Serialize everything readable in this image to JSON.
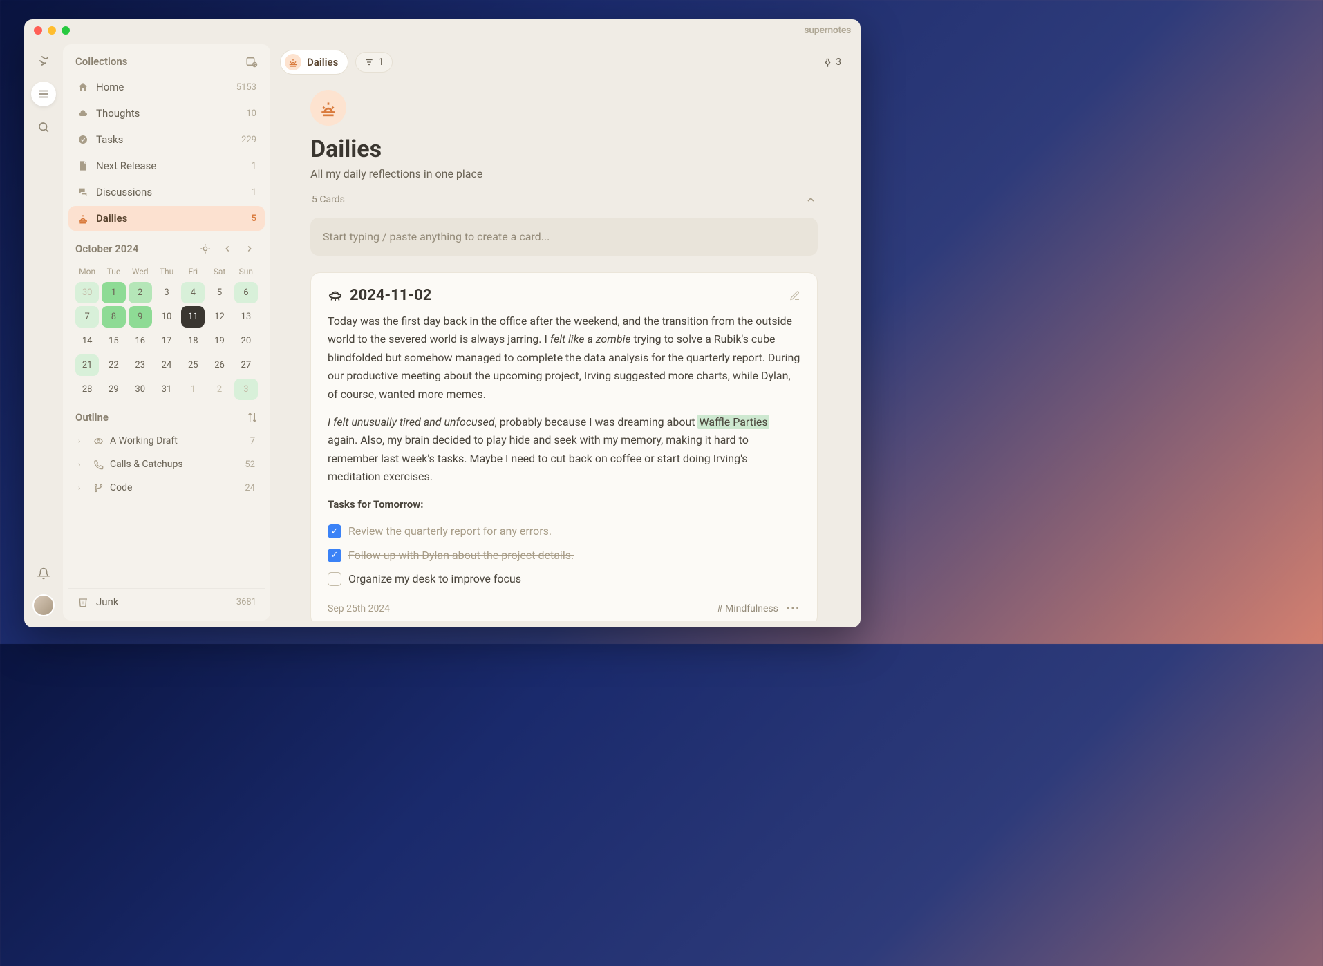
{
  "brand": "supernotes",
  "sidebar": {
    "title": "Collections",
    "items": [
      {
        "label": "Home",
        "count": "5153",
        "icon": "home"
      },
      {
        "label": "Thoughts",
        "count": "10",
        "icon": "thought"
      },
      {
        "label": "Tasks",
        "count": "229",
        "icon": "check"
      },
      {
        "label": "Next Release",
        "count": "1",
        "icon": "doc"
      },
      {
        "label": "Discussions",
        "count": "1",
        "icon": "chat"
      },
      {
        "label": "Dailies",
        "count": "5",
        "icon": "sunrise",
        "active": true
      }
    ],
    "junk": {
      "label": "Junk",
      "count": "3681"
    }
  },
  "calendar": {
    "title": "October 2024",
    "dow": [
      "Mon",
      "Tue",
      "Wed",
      "Thu",
      "Fri",
      "Sat",
      "Sun"
    ],
    "days": [
      {
        "n": "30",
        "dim": true,
        "heat": "light"
      },
      {
        "n": "1",
        "heat": "strong"
      },
      {
        "n": "2",
        "heat": "med"
      },
      {
        "n": "3"
      },
      {
        "n": "4",
        "heat": "light"
      },
      {
        "n": "5"
      },
      {
        "n": "6",
        "heat": "light"
      },
      {
        "n": "7",
        "heat": "light"
      },
      {
        "n": "8",
        "heat": "strong"
      },
      {
        "n": "9",
        "heat": "strong"
      },
      {
        "n": "10"
      },
      {
        "n": "11",
        "today": true
      },
      {
        "n": "12"
      },
      {
        "n": "13"
      },
      {
        "n": "14"
      },
      {
        "n": "15"
      },
      {
        "n": "16"
      },
      {
        "n": "17"
      },
      {
        "n": "18"
      },
      {
        "n": "19"
      },
      {
        "n": "20"
      },
      {
        "n": "21",
        "heat": "light"
      },
      {
        "n": "22"
      },
      {
        "n": "23"
      },
      {
        "n": "24"
      },
      {
        "n": "25"
      },
      {
        "n": "26"
      },
      {
        "n": "27"
      },
      {
        "n": "28"
      },
      {
        "n": "29"
      },
      {
        "n": "30"
      },
      {
        "n": "31"
      },
      {
        "n": "1",
        "dim": true
      },
      {
        "n": "2",
        "dim": true
      },
      {
        "n": "3",
        "dim": true,
        "heat": "light"
      }
    ]
  },
  "outline": {
    "title": "Outline",
    "items": [
      {
        "label": "A Working Draft",
        "count": "7",
        "icon": "draft"
      },
      {
        "label": "Calls & Catchups",
        "count": "52",
        "icon": "phone"
      },
      {
        "label": "Code",
        "count": "24",
        "icon": "branch"
      }
    ]
  },
  "header": {
    "breadcrumb": "Dailies",
    "filter_count": "1",
    "pin_count": "3"
  },
  "page": {
    "title": "Dailies",
    "description": "All my daily reflections in one place",
    "cards_count": "5 Cards",
    "compose_placeholder": "Start typing / paste anything to create a card..."
  },
  "card": {
    "title": "2024-11-02",
    "p1_a": "Today was the first day back in the office after the weekend, and the transition from the outside world to the severed world is always jarring. I ",
    "p1_em": "felt like a zombie",
    "p1_b": " trying to solve a Rubik's cube blindfolded but somehow managed to complete the data analysis for the quarterly report. During our productive meeting about the upcoming project, Irving suggested more charts, while Dylan, of course, wanted more memes.",
    "p2_em": "I felt unusually tired and unfocused",
    "p2_a": ", probably because I was dreaming about ",
    "p2_link": "Waffle Parties",
    "p2_b": " again. Also, my brain decided to play hide and seek with my memory, making it hard to remember last week's tasks. Maybe I need to cut back on coffee or start doing Irving's meditation exercises.",
    "tasks_heading": "Tasks for Tomorrow:",
    "tasks": [
      {
        "text": "Review the quarterly report for any errors.",
        "done": true
      },
      {
        "text": "Follow up with Dylan about the project details.",
        "done": true
      },
      {
        "text": "Organize my desk to improve focus",
        "done": false
      }
    ],
    "date": "Sep 25th 2024",
    "tag": "# Mindfulness"
  }
}
